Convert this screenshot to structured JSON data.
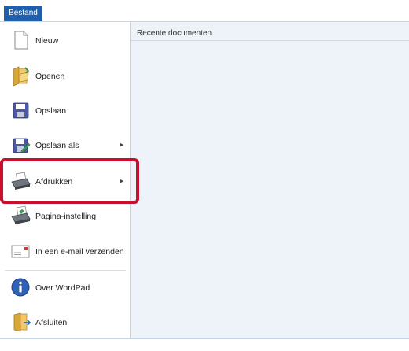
{
  "ribbon": {
    "tab_label": "Bestand"
  },
  "menu": {
    "items": [
      {
        "label": "Nieuw",
        "icon": "new-document-icon"
      },
      {
        "label": "Openen",
        "icon": "open-folder-icon"
      },
      {
        "label": "Opslaan",
        "icon": "save-disk-icon"
      },
      {
        "label": "Opslaan als",
        "icon": "save-as-icon",
        "arrow": "▶"
      },
      {
        "label": "Afdrukken",
        "icon": "printer-icon",
        "arrow": "▶"
      },
      {
        "label": "Pagina-instelling",
        "icon": "page-setup-icon"
      },
      {
        "label": "In een e-mail verzenden",
        "icon": "email-icon"
      },
      {
        "label": "Over WordPad",
        "icon": "info-icon"
      },
      {
        "label": "Afsluiten",
        "icon": "exit-icon"
      }
    ]
  },
  "recent": {
    "title": "Recente documenten"
  },
  "colors": {
    "tab_bg": "#1e5fae",
    "highlight": "#c8102e",
    "recent_bg": "#eef3f9"
  }
}
